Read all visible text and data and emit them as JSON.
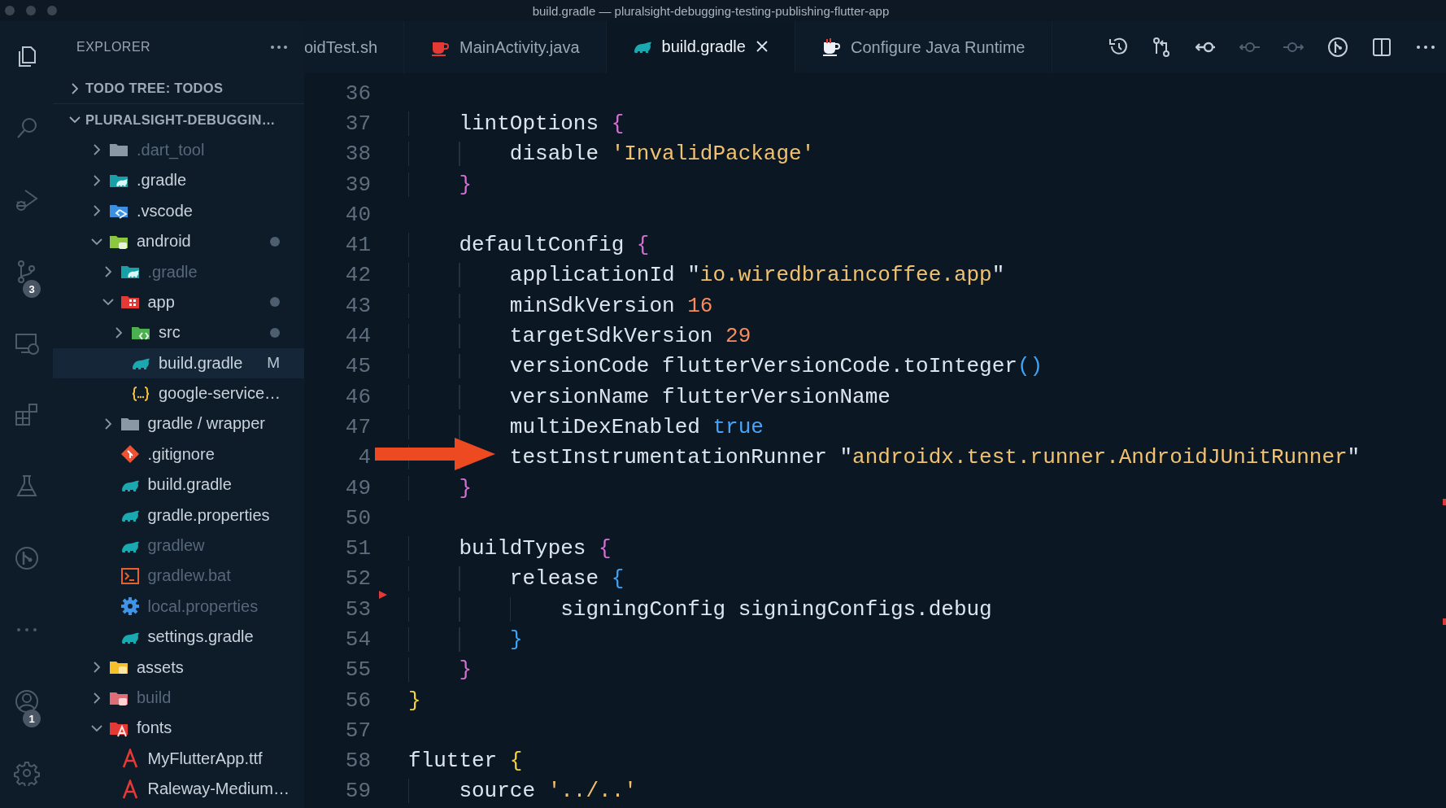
{
  "window": {
    "title": "build.gradle — pluralsight-debugging-testing-publishing-flutter-app"
  },
  "activity_bar": {
    "top": [
      {
        "kind": "explorer",
        "selected": true
      },
      {
        "kind": "search",
        "selected": false
      },
      {
        "kind": "run-debug",
        "selected": false
      },
      {
        "kind": "source-control",
        "selected": false,
        "badge": "3"
      },
      {
        "kind": "remote",
        "selected": false
      },
      {
        "kind": "extensions",
        "selected": false
      },
      {
        "kind": "testing",
        "selected": false
      },
      {
        "kind": "git-graph",
        "selected": false
      },
      {
        "kind": "more",
        "selected": false
      }
    ],
    "bottom": [
      {
        "kind": "account",
        "selected": false,
        "badge": "1"
      },
      {
        "kind": "settings",
        "selected": false
      }
    ]
  },
  "explorer": {
    "title": "EXPLORER",
    "sections": [
      {
        "title": "TODO TREE: TODOS",
        "expanded": false
      },
      {
        "title": "PLURALSIGHT-DEBUGGIN…",
        "expanded": true,
        "items": [
          {
            "label": ".dart_tool",
            "kind": "plain-folder",
            "expanded": false,
            "dimmed": true,
            "selected": false,
            "dot": false
          },
          {
            "label": ".gradle",
            "kind": "gradle-folder",
            "expanded": false,
            "dimmed": false,
            "selected": false,
            "dot": false
          },
          {
            "label": ".vscode",
            "kind": "vscode-folder",
            "expanded": false,
            "dimmed": false,
            "selected": false,
            "dot": false
          },
          {
            "label": "android",
            "kind": "android-folder",
            "expanded": true,
            "dimmed": false,
            "selected": false,
            "dot": true,
            "children": [
              {
                "label": ".gradle",
                "kind": "gradle-folder",
                "expanded": false,
                "dimmed": true,
                "selected": false,
                "dot": false
              },
              {
                "label": "app",
                "kind": "app-folder",
                "expanded": true,
                "dimmed": false,
                "selected": false,
                "dot": true,
                "children": [
                  {
                    "label": "src",
                    "kind": "src-folder",
                    "expanded": false,
                    "dimmed": false,
                    "selected": false,
                    "dot": true
                  },
                  {
                    "label": "build.gradle",
                    "kind": "gradle-file",
                    "dimmed": false,
                    "selected": true,
                    "dot": false,
                    "badge": "M"
                  },
                  {
                    "label": "google-service…",
                    "kind": "json-file",
                    "dimmed": false,
                    "selected": false,
                    "dot": false
                  }
                ]
              },
              {
                "label": "gradle / wrapper",
                "kind": "plain-folder",
                "expanded": false,
                "dimmed": false,
                "selected": false,
                "dot": false
              },
              {
                "label": ".gitignore",
                "kind": "git-file",
                "dimmed": false,
                "selected": false,
                "dot": false
              },
              {
                "label": "build.gradle",
                "kind": "gradle-file",
                "dimmed": false,
                "selected": false,
                "dot": false
              },
              {
                "label": "gradle.properties",
                "kind": "gradle-file",
                "dimmed": false,
                "selected": false,
                "dot": false
              },
              {
                "label": "gradlew",
                "kind": "gradle-file",
                "dimmed": true,
                "selected": false,
                "dot": false
              },
              {
                "label": "gradlew.bat",
                "kind": "script-file",
                "dimmed": true,
                "selected": false,
                "dot": false
              },
              {
                "label": "local.properties",
                "kind": "settings-file",
                "dimmed": true,
                "selected": false,
                "dot": false
              },
              {
                "label": "settings.gradle",
                "kind": "gradle-file",
                "dimmed": false,
                "selected": false,
                "dot": false
              }
            ]
          },
          {
            "label": "assets",
            "kind": "assets-folder",
            "expanded": false,
            "dimmed": false,
            "selected": false,
            "dot": false
          },
          {
            "label": "build",
            "kind": "build-folder",
            "expanded": false,
            "dimmed": true,
            "selected": false,
            "dot": false
          },
          {
            "label": "fonts",
            "kind": "fonts-folder",
            "expanded": true,
            "dimmed": false,
            "selected": false,
            "dot": false,
            "children": [
              {
                "label": "MyFlutterApp.ttf",
                "kind": "font-file",
                "dimmed": false,
                "selected": false,
                "dot": false
              },
              {
                "label": "Raleway-Medium…",
                "kind": "font-file",
                "dimmed": false,
                "selected": false,
                "dot": false
              }
            ]
          }
        ]
      }
    ]
  },
  "tabs": [
    {
      "label": "oidTest.sh",
      "selected": false
    },
    {
      "label": "MainActivity.java",
      "kind": "java",
      "selected": false
    },
    {
      "label": "build.gradle",
      "kind": "gradle",
      "selected": true
    },
    {
      "label": "Configure Java Runtime",
      "kind": "runtime",
      "selected": false
    }
  ],
  "toolbar": [
    {
      "kind": "history",
      "disabled": false
    },
    {
      "kind": "compare",
      "disabled": false
    },
    {
      "kind": "back",
      "disabled": false
    },
    {
      "kind": "previous",
      "disabled": true
    },
    {
      "kind": "next",
      "disabled": true
    },
    {
      "kind": "git-graph",
      "disabled": false
    },
    {
      "kind": "split",
      "disabled": false
    },
    {
      "kind": "more",
      "disabled": false
    }
  ],
  "lines": [
    {
      "number": "36",
      "change_marker": false,
      "arrow": false
    },
    {
      "number": "37",
      "change_marker": false,
      "arrow": false,
      "tokens": [
        {
          "text": "    lintOptions ",
          "kind": "plain"
        },
        {
          "text": "{",
          "kind": "brace"
        }
      ]
    },
    {
      "number": "38",
      "change_marker": false,
      "arrow": false,
      "tokens": [
        {
          "text": "        disable ",
          "kind": "plain"
        },
        {
          "text": "'InvalidPackage'",
          "kind": "string"
        }
      ]
    },
    {
      "number": "39",
      "change_marker": false,
      "arrow": false,
      "tokens": [
        {
          "text": "    }",
          "kind": "brace"
        }
      ]
    },
    {
      "number": "40",
      "change_marker": false,
      "arrow": false
    },
    {
      "number": "41",
      "change_marker": false,
      "arrow": false,
      "tokens": [
        {
          "text": "    defaultConfig ",
          "kind": "plain"
        },
        {
          "text": "{",
          "kind": "brace"
        }
      ]
    },
    {
      "number": "42",
      "change_marker": false,
      "arrow": false,
      "tokens": [
        {
          "text": "        applicationId \"",
          "kind": "plain"
        },
        {
          "text": "io.wiredbraincoffee.app",
          "kind": "string"
        },
        {
          "text": "\"",
          "kind": "plain"
        }
      ]
    },
    {
      "number": "43",
      "change_marker": false,
      "arrow": false,
      "tokens": [
        {
          "text": "        minSdkVersion ",
          "kind": "plain"
        },
        {
          "text": "16",
          "kind": "number"
        }
      ]
    },
    {
      "number": "44",
      "change_marker": false,
      "arrow": false,
      "tokens": [
        {
          "text": "        targetSdkVersion ",
          "kind": "plain"
        },
        {
          "text": "29",
          "kind": "number"
        }
      ]
    },
    {
      "number": "45",
      "change_marker": false,
      "arrow": false,
      "tokens": [
        {
          "text": "        versionCode flutterVersionCode.toInteger",
          "kind": "plain"
        },
        {
          "text": "()",
          "kind": "brace"
        }
      ]
    },
    {
      "number": "46",
      "change_marker": false,
      "arrow": false,
      "tokens": [
        {
          "text": "        versionName flutterVersionName",
          "kind": "plain"
        }
      ]
    },
    {
      "number": "47",
      "change_marker": false,
      "arrow": false,
      "tokens": [
        {
          "text": "        multiDexEnabled ",
          "kind": "plain"
        },
        {
          "text": "true",
          "kind": "keyword"
        }
      ]
    },
    {
      "number": "4",
      "change_marker": false,
      "arrow": true,
      "tokens": [
        {
          "text": "        testInstrumentationRunner \"",
          "kind": "plain"
        },
        {
          "text": "androidx.test.runner.AndroidJUnitRunner",
          "kind": "string"
        },
        {
          "text": "\"",
          "kind": "plain"
        }
      ]
    },
    {
      "number": "49",
      "change_marker": false,
      "arrow": false,
      "tokens": [
        {
          "text": "    }",
          "kind": "brace"
        }
      ]
    },
    {
      "number": "50",
      "change_marker": false,
      "arrow": false
    },
    {
      "number": "51",
      "change_marker": false,
      "arrow": false,
      "tokens": [
        {
          "text": "    buildTypes ",
          "kind": "plain"
        },
        {
          "text": "{",
          "kind": "brace"
        }
      ]
    },
    {
      "number": "52",
      "change_marker": false,
      "arrow": false,
      "tokens": [
        {
          "text": "        release ",
          "kind": "plain"
        },
        {
          "text": "{",
          "kind": "brace"
        }
      ]
    },
    {
      "number": "53",
      "change_marker": true,
      "arrow": false,
      "tokens": [
        {
          "text": "            signingConfig signingConfigs.debug",
          "kind": "plain"
        }
      ]
    },
    {
      "number": "54",
      "change_marker": false,
      "arrow": false,
      "tokens": [
        {
          "text": "        }",
          "kind": "brace"
        }
      ]
    },
    {
      "number": "55",
      "change_marker": false,
      "arrow": false,
      "tokens": [
        {
          "text": "    }",
          "kind": "brace"
        }
      ]
    },
    {
      "number": "56",
      "change_marker": false,
      "arrow": false,
      "tokens": [
        {
          "text": "}",
          "kind": "brace"
        }
      ]
    },
    {
      "number": "57",
      "change_marker": false,
      "arrow": false
    },
    {
      "number": "58",
      "change_marker": false,
      "arrow": false,
      "tokens": [
        {
          "text": "flutter ",
          "kind": "plain"
        },
        {
          "text": "{",
          "kind": "brace"
        }
      ]
    },
    {
      "number": "59",
      "change_marker": false,
      "arrow": false,
      "tokens": [
        {
          "text": "    source ",
          "kind": "plain"
        },
        {
          "text": "'../..'",
          "kind": "string"
        }
      ]
    }
  ]
}
